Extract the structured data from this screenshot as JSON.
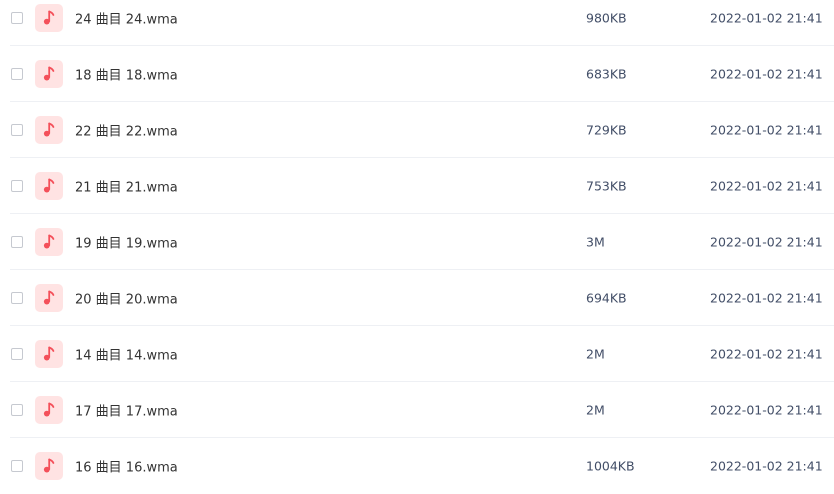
{
  "accent_color": "#f4505a",
  "icon_background": "#ffe3e3",
  "files": [
    {
      "name": "24 曲目 24.wma",
      "size": "980KB",
      "modified": "2022-01-02 21:41",
      "icon": "music-note-icon"
    },
    {
      "name": "18 曲目 18.wma",
      "size": "683KB",
      "modified": "2022-01-02 21:41",
      "icon": "music-note-icon"
    },
    {
      "name": "22 曲目 22.wma",
      "size": "729KB",
      "modified": "2022-01-02 21:41",
      "icon": "music-note-icon"
    },
    {
      "name": "21 曲目 21.wma",
      "size": "753KB",
      "modified": "2022-01-02 21:41",
      "icon": "music-note-icon"
    },
    {
      "name": "19 曲目 19.wma",
      "size": "3M",
      "modified": "2022-01-02 21:41",
      "icon": "music-note-icon"
    },
    {
      "name": "20 曲目 20.wma",
      "size": "694KB",
      "modified": "2022-01-02 21:41",
      "icon": "music-note-icon"
    },
    {
      "name": "14 曲目 14.wma",
      "size": "2M",
      "modified": "2022-01-02 21:41",
      "icon": "music-note-icon"
    },
    {
      "name": "17 曲目 17.wma",
      "size": "2M",
      "modified": "2022-01-02 21:41",
      "icon": "music-note-icon"
    },
    {
      "name": "16 曲目 16.wma",
      "size": "1004KB",
      "modified": "2022-01-02 21:41",
      "icon": "music-note-icon"
    }
  ]
}
